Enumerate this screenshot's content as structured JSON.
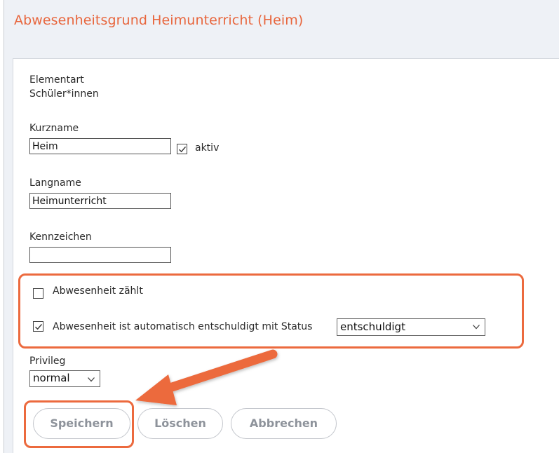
{
  "header": {
    "title": "Abwesenheitsgrund Heimunterricht (Heim)"
  },
  "form": {
    "elementart": {
      "label": "Elementart",
      "value": "Schüler*innen"
    },
    "kurzname": {
      "label": "Kurzname",
      "value": "Heim",
      "aktiv_label": "aktiv",
      "aktiv_checked": true
    },
    "langname": {
      "label": "Langname",
      "value": "Heimunterricht"
    },
    "kennzeichen": {
      "label": "Kennzeichen",
      "value": ""
    },
    "abwesenheit_zaehlt": {
      "label": "Abwesenheit zählt",
      "checked": false
    },
    "auto_entschuldigt": {
      "label": "Abwesenheit ist automatisch entschuldigt mit Status",
      "checked": true,
      "status_value": "entschuldigt"
    },
    "privileg": {
      "label": "Privileg",
      "value": "normal"
    }
  },
  "buttons": {
    "save": "Speichern",
    "delete": "Löschen",
    "cancel": "Abbrechen"
  },
  "colors": {
    "accent": "#ec6a3e",
    "title": "#e8663d",
    "button_text": "#8e939b"
  }
}
